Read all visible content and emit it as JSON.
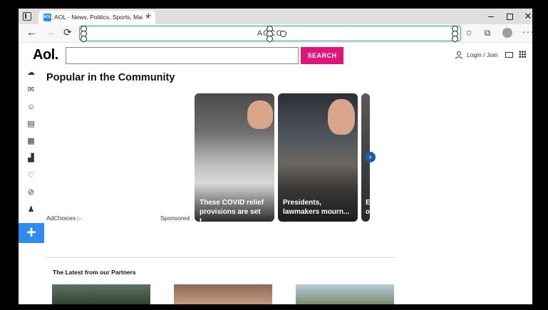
{
  "browser": {
    "tab_title": "AOL - News, Politics, Sports, Mail",
    "tab_close": "×",
    "new_tab": "+",
    "window_close": "✕",
    "address_text": "AOCO",
    "accent": "#1fa39a"
  },
  "header": {
    "logo": "Aol.",
    "search_button": "SEARCH",
    "search_placeholder": "",
    "login": "Login / Join",
    "brand_color": "#e0157b"
  },
  "rail": {
    "icons": [
      "weather-icon",
      "mail-icon",
      "person-icon",
      "news-icon",
      "entertainment-icon",
      "finance-icon",
      "lifestyle-icon",
      "sports-icon",
      "games-icon"
    ],
    "plus": "+",
    "plus_color": "#2d8cf0"
  },
  "community": {
    "title": "Popular in the Community",
    "cards": [
      {
        "text": "These COVID relief provisions are set t..."
      },
      {
        "text": "Presidents, lawmakers mourn..."
      },
      {
        "text": "E o"
      }
    ],
    "adchoices": "AdChoices",
    "sponsored": "Sponsored"
  },
  "partners": {
    "title": "The Latest from our Partners"
  }
}
